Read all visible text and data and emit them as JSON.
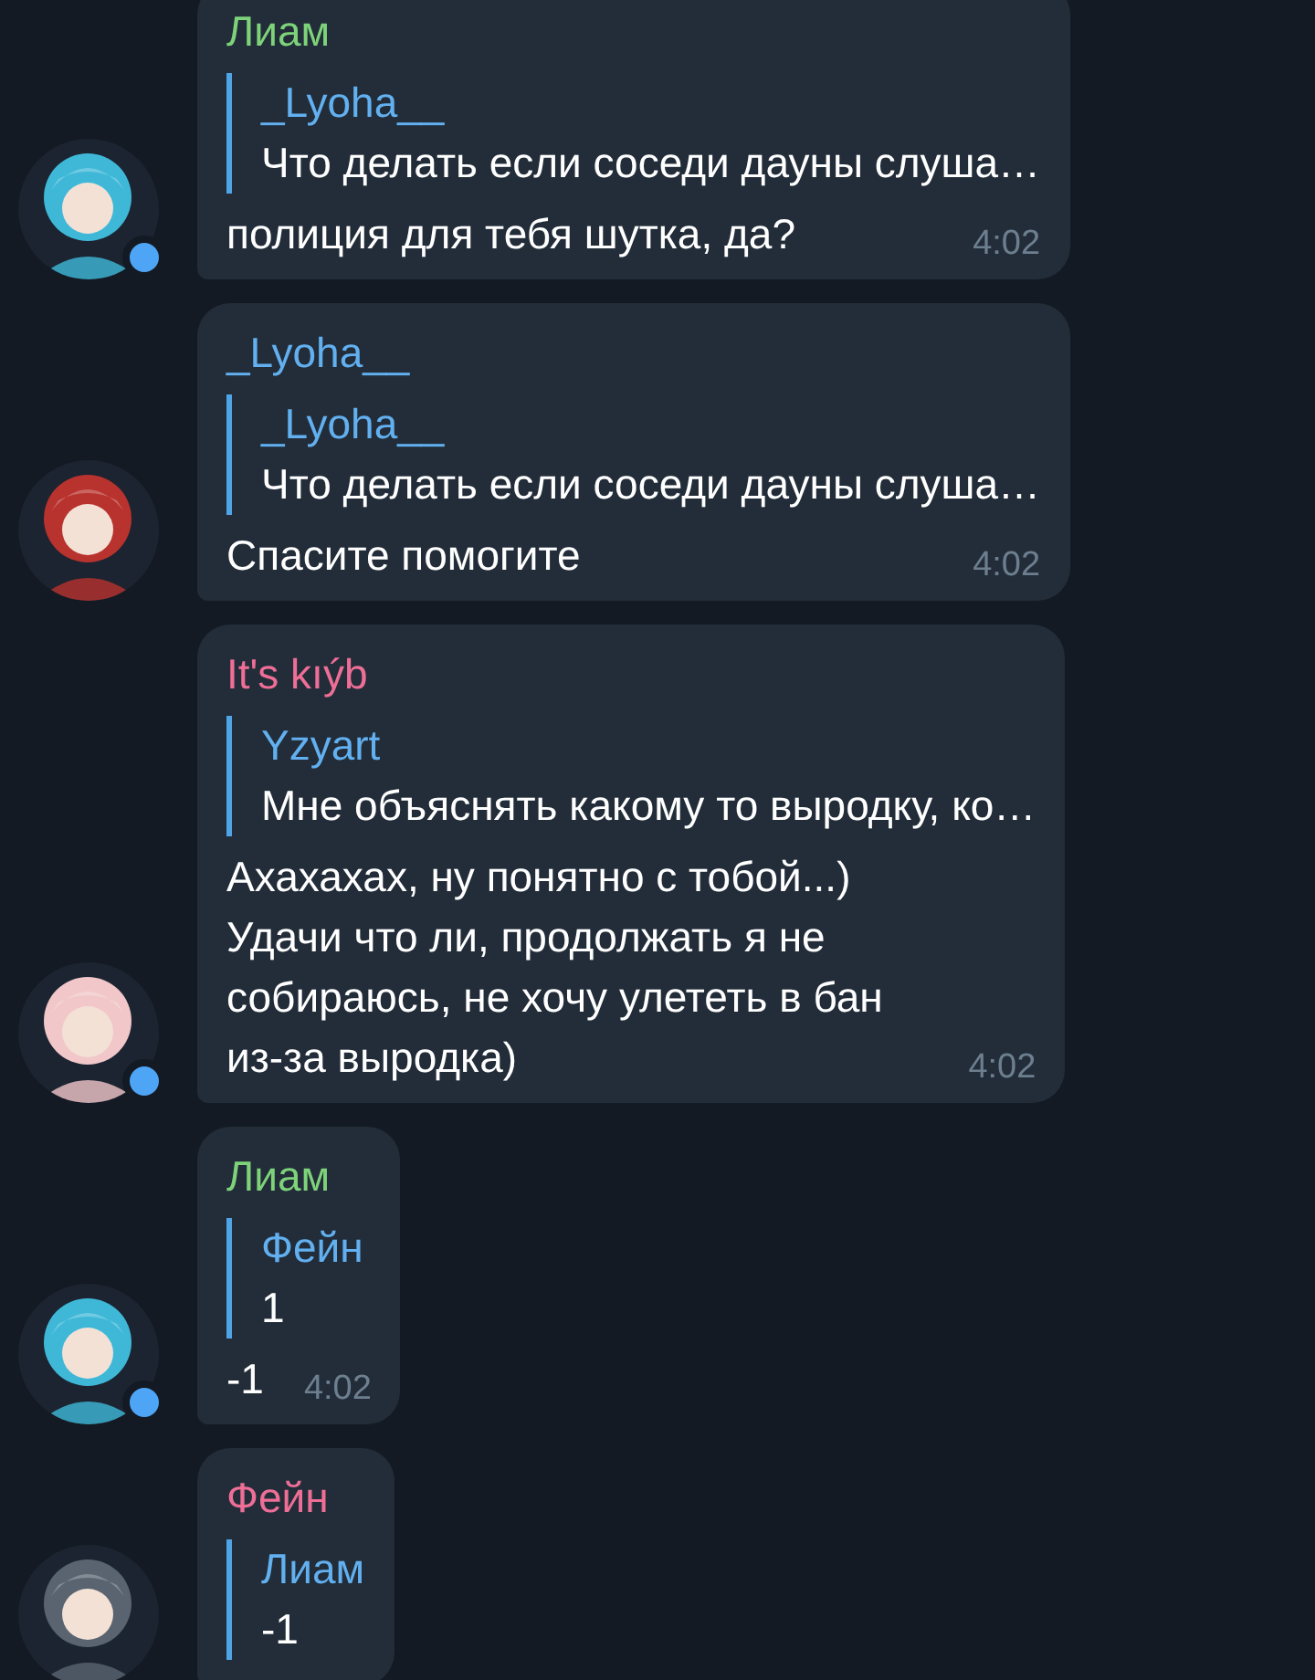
{
  "messages": [
    {
      "sender": "Лиам",
      "color": "#7ed37a",
      "online": true,
      "reply": {
        "author": "_Lyoha__",
        "text": "Что делать если соседи дауны слуша…"
      },
      "text": "полиция для тебя шутка, да?",
      "time": "4:02"
    },
    {
      "sender": "_Lyoha__",
      "color": "#62b0f0",
      "online": false,
      "reply": {
        "author": "_Lyoha__",
        "text": "Что делать если соседи дауны слуша…"
      },
      "text": "Спасите помогите",
      "time": "4:02"
    },
    {
      "sender": "It's kıýb",
      "color": "#ee6e96",
      "online": true,
      "reply": {
        "author": "Yzyart",
        "text": "Мне объяснять какому то выродку, ко…"
      },
      "text": "Ахахахах, ну понятно с тобой...)\nУдачи что ли, продолжать я не\nсобираюсь, не хочу улететь в бан\nиз-за выродка)",
      "time": "4:02"
    },
    {
      "sender": "Лиам",
      "color": "#7ed37a",
      "online": true,
      "reply": {
        "author": "Фейн",
        "text": "1"
      },
      "text": "-1",
      "time": "4:02"
    },
    {
      "sender": "Фейн",
      "color": "#ee6e96",
      "online": false,
      "reply": {
        "author": "Лиам",
        "text": "-1"
      }
    }
  ]
}
